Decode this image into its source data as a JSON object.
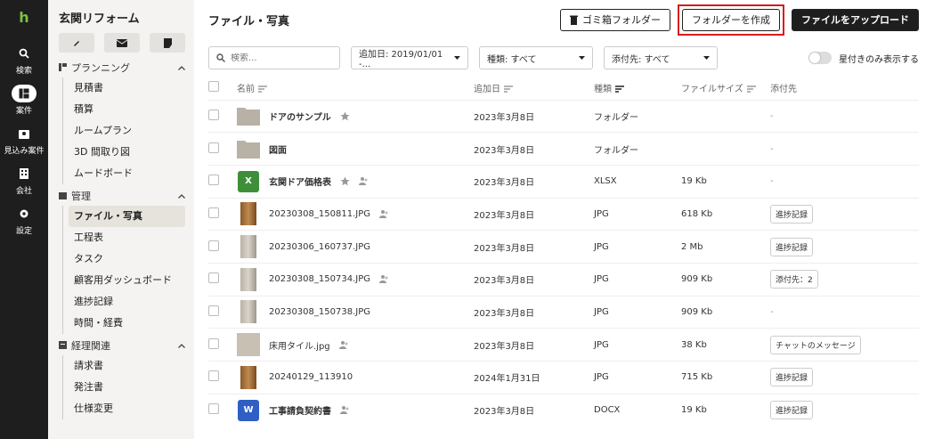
{
  "rail": [
    {
      "label": "検索",
      "icon": "search-icon"
    },
    {
      "label": "案件",
      "icon": "projects-icon",
      "active": true
    },
    {
      "label": "見込み案件",
      "icon": "leads-icon"
    },
    {
      "label": "会社",
      "icon": "company-icon"
    },
    {
      "label": "設定",
      "icon": "gear-icon"
    }
  ],
  "sidebar": {
    "project_title": "玄関リフォーム",
    "sections": [
      {
        "title": "プランニング",
        "items": [
          "見積書",
          "積算",
          "ルームプラン",
          "3D 間取り図",
          "ムードボード"
        ]
      },
      {
        "title": "管理",
        "items": [
          "ファイル・写真",
          "工程表",
          "タスク",
          "顧客用ダッシュボード",
          "進捗記録",
          "時間・経費"
        ]
      },
      {
        "title": "経理関連",
        "items": [
          "請求書",
          "発注書",
          "仕様変更"
        ]
      }
    ],
    "active_item": "ファイル・写真"
  },
  "header": {
    "title": "ファイル・写真",
    "trash_label": "ゴミ箱フォルダー",
    "create_folder_label": "フォルダーを作成",
    "upload_label": "ファイルをアップロード"
  },
  "filters": {
    "search_placeholder": "検索...",
    "date_filter": "追加日: 2019/01/01 -...",
    "type_filter": "種類: すべて",
    "attach_filter": "添付先: すべて",
    "starred_only": "星付きのみ表示する"
  },
  "table": {
    "columns": {
      "name": "名前",
      "added": "追加日",
      "type": "種類",
      "size": "ファイルサイズ",
      "attached": "添付先"
    },
    "rows": [
      {
        "name": "ドアのサンプル",
        "bold": true,
        "thumb": "folder",
        "star": true,
        "share": false,
        "added": "2023年3月8日",
        "type": "フォルダー",
        "size": "",
        "attached": "-",
        "attached_tag": false
      },
      {
        "name": "図面",
        "bold": true,
        "thumb": "folder",
        "star": false,
        "share": false,
        "added": "2023年3月8日",
        "type": "フォルダー",
        "size": "",
        "attached": "-",
        "attached_tag": false
      },
      {
        "name": "玄関ドア価格表",
        "bold": true,
        "thumb": "xlsx",
        "star": true,
        "share": true,
        "added": "2023年3月8日",
        "type": "XLSX",
        "size": "19 Kb",
        "attached": "-",
        "attached_tag": false
      },
      {
        "name": "20230308_150811.JPG",
        "bold": false,
        "thumb": "photo-door",
        "star": false,
        "share": true,
        "added": "2023年3月8日",
        "type": "JPG",
        "size": "618 Kb",
        "attached": "進捗記録",
        "attached_tag": true
      },
      {
        "name": "20230306_160737.JPG",
        "bold": false,
        "thumb": "photo-wall",
        "star": false,
        "share": false,
        "added": "2023年3月8日",
        "type": "JPG",
        "size": "2 Mb",
        "attached": "進捗記録",
        "attached_tag": true
      },
      {
        "name": "20230308_150734.JPG",
        "bold": false,
        "thumb": "photo-wall",
        "star": false,
        "share": true,
        "added": "2023年3月8日",
        "type": "JPG",
        "size": "909 Kb",
        "attached": "添付先：2",
        "attached_tag": true
      },
      {
        "name": "20230308_150738.JPG",
        "bold": false,
        "thumb": "photo-wall",
        "star": false,
        "share": false,
        "added": "2023年3月8日",
        "type": "JPG",
        "size": "909 Kb",
        "attached": "-",
        "attached_tag": false
      },
      {
        "name": "床用タイル.jpg",
        "bold": false,
        "thumb": "photo-tile",
        "star": false,
        "share": true,
        "added": "2023年3月8日",
        "type": "JPG",
        "size": "38 Kb",
        "attached": "チャットのメッセージ",
        "attached_tag": true
      },
      {
        "name": "20240129_113910",
        "bold": false,
        "thumb": "photo-door",
        "star": false,
        "share": false,
        "added": "2024年1月31日",
        "type": "JPG",
        "size": "715 Kb",
        "attached": "進捗記録",
        "attached_tag": true
      },
      {
        "name": "工事請負契約書",
        "bold": true,
        "thumb": "docx",
        "star": false,
        "share": true,
        "added": "2023年3月8日",
        "type": "DOCX",
        "size": "19 Kb",
        "attached": "進捗記録",
        "attached_tag": true
      }
    ]
  },
  "colors": {
    "rail_bg": "#1e1e1e",
    "sidebar_bg": "#f4f3f1",
    "highlight": "#d81c1c",
    "xlsx": "#3f8f3a",
    "docx": "#2f5fc4",
    "folder": "#b8b1a6"
  }
}
